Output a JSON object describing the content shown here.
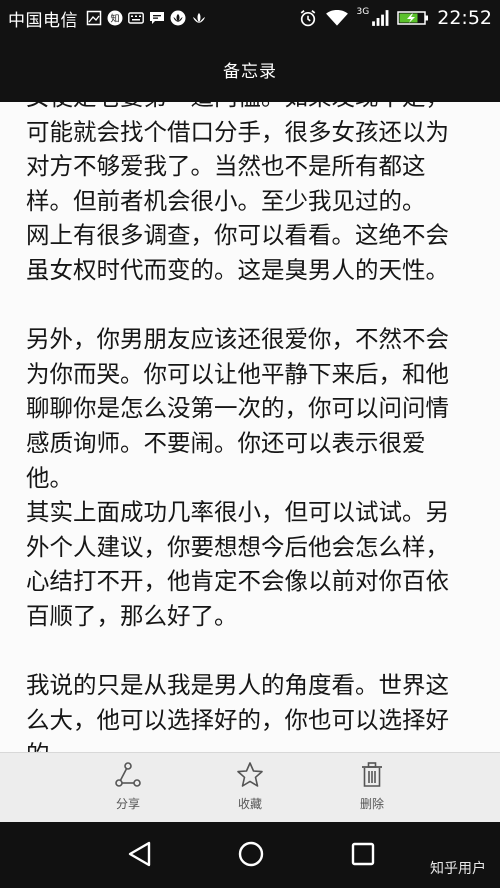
{
  "status_bar": {
    "carrier": "中国电信",
    "network_label": "3G",
    "time": "22:52",
    "icons": [
      "image-icon",
      "zhihu-icon",
      "keyboard-icon",
      "message-icon",
      "huawei-icon",
      "huawei-icon",
      "alarm-icon",
      "wifi-icon",
      "signal-icon",
      "battery-charging-icon"
    ]
  },
  "header": {
    "title": "备忘录"
  },
  "content": {
    "text": "女使是老婆第一道门槛。如果发现不是，\n可能就会找个借口分手，很多女孩还以为\n对方不够爱我了。当然也不是所有都这\n样。但前者机会很小。至少我见过的。\n网上有很多调查，你可以看看。这绝不会\n虽女权时代而变的。这是臭男人的天性。\n\n另外，你男朋友应该还很爱你，不然不会\n为你而哭。你可以让他平静下来后，和他\n聊聊你是怎么没第一次的，你可以问问情\n感质询师。不要闹。你还可以表示很爱\n他。\n其实上面成功几率很小，但可以试试。另\n外个人建议，你要想想今后他会怎么样，\n心结打不开，他肯定不会像以前对你百依\n百顺了，那么好了。\n\n我说的只是从我是男人的角度看。世界这\n么大，他可以选择好的，你也可以选择好\n的。"
  },
  "toolbar": {
    "share_label": "分享",
    "favorite_label": "收藏",
    "delete_label": "删除"
  },
  "nav_bar": {
    "buttons": [
      "back-icon",
      "home-icon",
      "recents-icon"
    ]
  },
  "watermark": "知乎用户"
}
